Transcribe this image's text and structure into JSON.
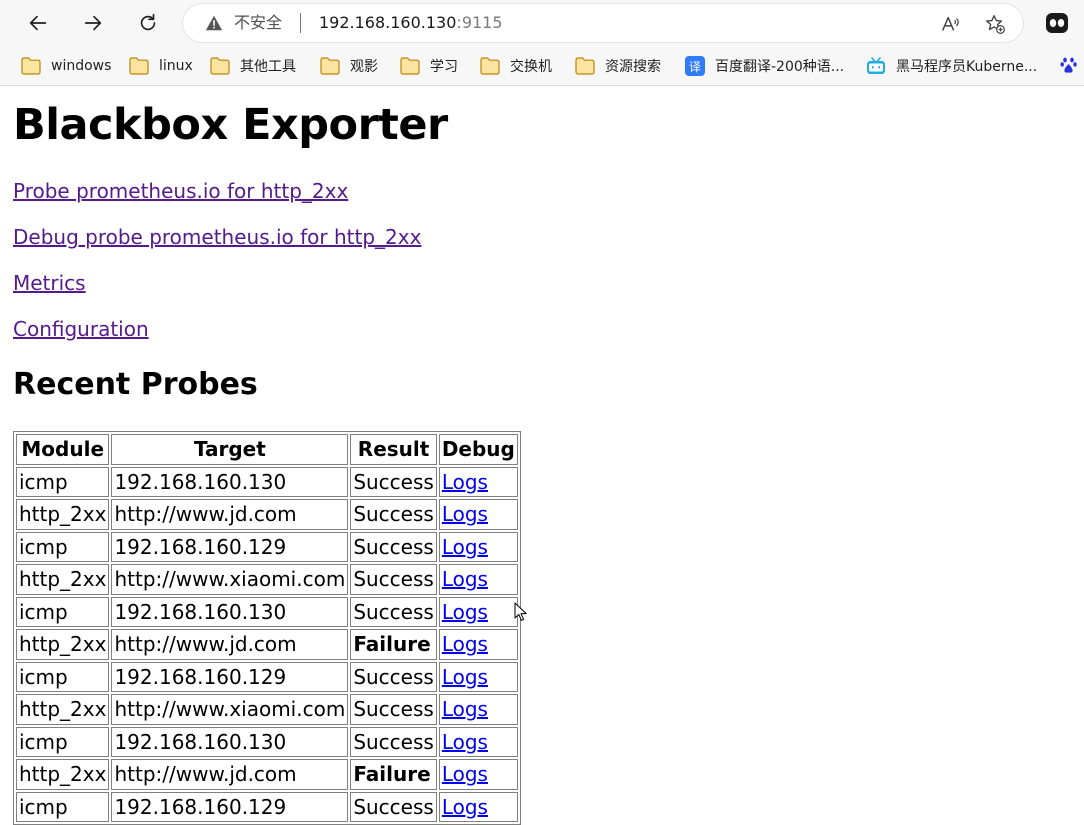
{
  "browser": {
    "insecure_label": "不安全",
    "url_host": "192.168.160.130",
    "url_port": ":9115"
  },
  "bookmarks": [
    {
      "label": "windows",
      "icon": "folder-icon"
    },
    {
      "label": "linux",
      "icon": "folder-icon"
    },
    {
      "label": "其他工具",
      "icon": "folder-icon"
    },
    {
      "label": "观影",
      "icon": "folder-icon"
    },
    {
      "label": "学习",
      "icon": "folder-icon"
    },
    {
      "label": "交换机",
      "icon": "folder-icon"
    },
    {
      "label": "资源搜索",
      "icon": "folder-icon"
    },
    {
      "label": "百度翻译-200种语...",
      "icon": "translate-icon",
      "icon_text": "译"
    },
    {
      "label": "黑马程序员Kuberne...",
      "icon": "bilibili-icon"
    }
  ],
  "page": {
    "title": "Blackbox Exporter",
    "links": [
      "Probe prometheus.io for http_2xx",
      "Debug probe prometheus.io for http_2xx",
      "Metrics",
      "Configuration"
    ],
    "recent_title": "Recent Probes"
  },
  "table": {
    "headers": [
      "Module",
      "Target",
      "Result",
      "Debug"
    ],
    "rows": [
      {
        "module": "icmp",
        "target": "192.168.160.130",
        "result": "Success",
        "debug": "Logs"
      },
      {
        "module": "http_2xx",
        "target": "http://www.jd.com",
        "result": "Success",
        "debug": "Logs"
      },
      {
        "module": "icmp",
        "target": "192.168.160.129",
        "result": "Success",
        "debug": "Logs"
      },
      {
        "module": "http_2xx",
        "target": "http://www.xiaomi.com",
        "result": "Success",
        "debug": "Logs"
      },
      {
        "module": "icmp",
        "target": "192.168.160.130",
        "result": "Success",
        "debug": "Logs"
      },
      {
        "module": "http_2xx",
        "target": "http://www.jd.com",
        "result": "Failure",
        "debug": "Logs"
      },
      {
        "module": "icmp",
        "target": "192.168.160.129",
        "result": "Success",
        "debug": "Logs"
      },
      {
        "module": "http_2xx",
        "target": "http://www.xiaomi.com",
        "result": "Success",
        "debug": "Logs"
      },
      {
        "module": "icmp",
        "target": "192.168.160.130",
        "result": "Success",
        "debug": "Logs"
      },
      {
        "module": "http_2xx",
        "target": "http://www.jd.com",
        "result": "Failure",
        "debug": "Logs"
      },
      {
        "module": "icmp",
        "target": "192.168.160.129",
        "result": "Success",
        "debug": "Logs"
      }
    ]
  },
  "colors": {
    "visited_link": "#551a8b",
    "link": "#0000ee",
    "folder": "#f2c14e",
    "translate_badge": "#2f7cf6",
    "bilibili_badge": "#23ade5"
  }
}
